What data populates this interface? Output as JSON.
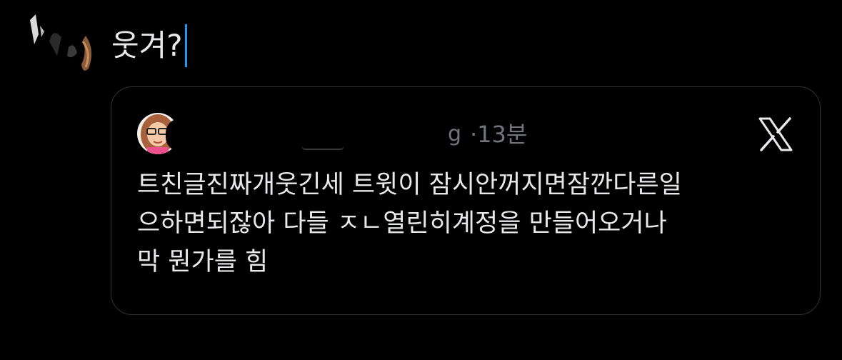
{
  "composer": {
    "text": "웃겨?",
    "avatar_icon": "user-avatar-icon"
  },
  "quote": {
    "handle_tail": "g",
    "separator": "·",
    "time": "13분",
    "dismiss_icon": "x-logo-icon",
    "body_lines": [
      "트친글진짜개웃긴세 트윗이 잠시안꺼지면잠깐다른일",
      "으하면되잖아 다들 ㅈㄴ열린히계정을 만들어오거나",
      "막 뭔가를 힘"
    ]
  },
  "colors": {
    "background": "#000000",
    "text": "#e7e9ea",
    "muted": "#71767b",
    "border": "#2f3336",
    "caret": "#1d9bf0"
  }
}
